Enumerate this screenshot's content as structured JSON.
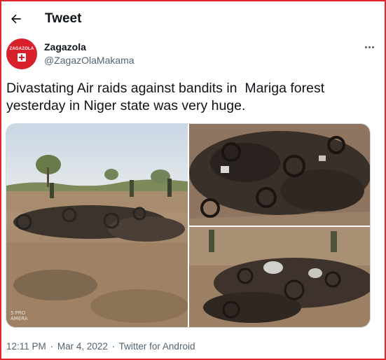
{
  "header": {
    "title": "Tweet",
    "back_icon": "arrow-left-icon"
  },
  "author": {
    "display_name": "Zagazola",
    "handle": "@ZagazOlaMakama",
    "avatar_label": "ZAGAZOLA",
    "avatar_color": "#d8202b"
  },
  "tweet": {
    "text": "Divastating Air raids against bandits in  Mariga forest yesterday in Niger state was very huge."
  },
  "media": {
    "photos": [
      {
        "subject": "scrub field with armed men beside burnt motorcycles"
      },
      {
        "subject": "close view of charred motorcycle wreckage"
      },
      {
        "subject": "burnt motorcycles on dry ground with soldiers"
      }
    ],
    "watermark": "5 PRO\nAMERA"
  },
  "meta": {
    "time": "12:11 PM",
    "separator": "·",
    "date": "Mar 4, 2022",
    "source": "Twitter for Android"
  },
  "colors": {
    "frame": "#e0262b",
    "text": "#0f1419",
    "secondary": "#536471",
    "border": "#cfd9de"
  }
}
